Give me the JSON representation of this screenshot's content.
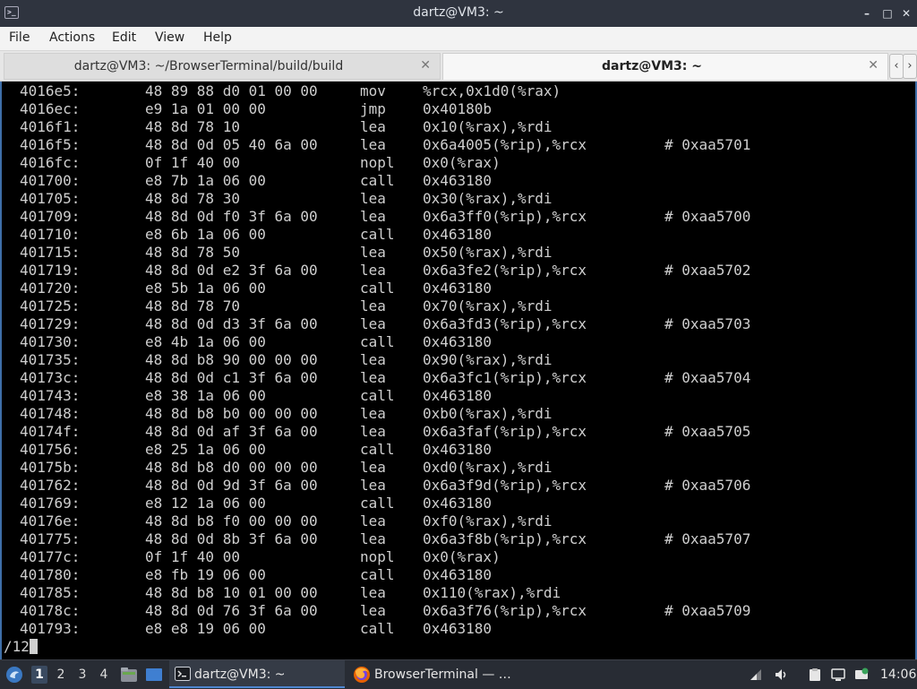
{
  "window": {
    "title": "dartz@VM3: ~",
    "minimize_glyph": "–",
    "maximize_glyph": "□",
    "close_glyph": "✕"
  },
  "menu": [
    "File",
    "Actions",
    "Edit",
    "View",
    "Help"
  ],
  "tabs": [
    {
      "label": "dartz@VM3: ~/BrowserTerminal/build/build",
      "active": false
    },
    {
      "label": "dartz@VM3: ~",
      "active": true
    }
  ],
  "tab_nav": {
    "prev": "‹",
    "next": "›"
  },
  "terminal": {
    "lines": [
      {
        "addr": "4016e5:",
        "bytes": "48 89 88 d0 01 00 00",
        "op": "mov",
        "args": "%rcx,0x1d0(%rax)",
        "comment": ""
      },
      {
        "addr": "4016ec:",
        "bytes": "e9 1a 01 00 00",
        "op": "jmp",
        "args": "0x40180b",
        "comment": ""
      },
      {
        "addr": "4016f1:",
        "bytes": "48 8d 78 10",
        "op": "lea",
        "args": "0x10(%rax),%rdi",
        "comment": ""
      },
      {
        "addr": "4016f5:",
        "bytes": "48 8d 0d 05 40 6a 00",
        "op": "lea",
        "args": "0x6a4005(%rip),%rcx",
        "comment": "# 0xaa5701"
      },
      {
        "addr": "4016fc:",
        "bytes": "0f 1f 40 00",
        "op": "nopl",
        "args": "0x0(%rax)",
        "comment": ""
      },
      {
        "addr": "401700:",
        "bytes": "e8 7b 1a 06 00",
        "op": "call",
        "args": "0x463180",
        "comment": ""
      },
      {
        "addr": "401705:",
        "bytes": "48 8d 78 30",
        "op": "lea",
        "args": "0x30(%rax),%rdi",
        "comment": ""
      },
      {
        "addr": "401709:",
        "bytes": "48 8d 0d f0 3f 6a 00",
        "op": "lea",
        "args": "0x6a3ff0(%rip),%rcx",
        "comment": "# 0xaa5700"
      },
      {
        "addr": "401710:",
        "bytes": "e8 6b 1a 06 00",
        "op": "call",
        "args": "0x463180",
        "comment": ""
      },
      {
        "addr": "401715:",
        "bytes": "48 8d 78 50",
        "op": "lea",
        "args": "0x50(%rax),%rdi",
        "comment": ""
      },
      {
        "addr": "401719:",
        "bytes": "48 8d 0d e2 3f 6a 00",
        "op": "lea",
        "args": "0x6a3fe2(%rip),%rcx",
        "comment": "# 0xaa5702"
      },
      {
        "addr": "401720:",
        "bytes": "e8 5b 1a 06 00",
        "op": "call",
        "args": "0x463180",
        "comment": ""
      },
      {
        "addr": "401725:",
        "bytes": "48 8d 78 70",
        "op": "lea",
        "args": "0x70(%rax),%rdi",
        "comment": ""
      },
      {
        "addr": "401729:",
        "bytes": "48 8d 0d d3 3f 6a 00",
        "op": "lea",
        "args": "0x6a3fd3(%rip),%rcx",
        "comment": "# 0xaa5703"
      },
      {
        "addr": "401730:",
        "bytes": "e8 4b 1a 06 00",
        "op": "call",
        "args": "0x463180",
        "comment": ""
      },
      {
        "addr": "401735:",
        "bytes": "48 8d b8 90 00 00 00",
        "op": "lea",
        "args": "0x90(%rax),%rdi",
        "comment": ""
      },
      {
        "addr": "40173c:",
        "bytes": "48 8d 0d c1 3f 6a 00",
        "op": "lea",
        "args": "0x6a3fc1(%rip),%rcx",
        "comment": "# 0xaa5704"
      },
      {
        "addr": "401743:",
        "bytes": "e8 38 1a 06 00",
        "op": "call",
        "args": "0x463180",
        "comment": ""
      },
      {
        "addr": "401748:",
        "bytes": "48 8d b8 b0 00 00 00",
        "op": "lea",
        "args": "0xb0(%rax),%rdi",
        "comment": ""
      },
      {
        "addr": "40174f:",
        "bytes": "48 8d 0d af 3f 6a 00",
        "op": "lea",
        "args": "0x6a3faf(%rip),%rcx",
        "comment": "# 0xaa5705"
      },
      {
        "addr": "401756:",
        "bytes": "e8 25 1a 06 00",
        "op": "call",
        "args": "0x463180",
        "comment": ""
      },
      {
        "addr": "40175b:",
        "bytes": "48 8d b8 d0 00 00 00",
        "op": "lea",
        "args": "0xd0(%rax),%rdi",
        "comment": ""
      },
      {
        "addr": "401762:",
        "bytes": "48 8d 0d 9d 3f 6a 00",
        "op": "lea",
        "args": "0x6a3f9d(%rip),%rcx",
        "comment": "# 0xaa5706"
      },
      {
        "addr": "401769:",
        "bytes": "e8 12 1a 06 00",
        "op": "call",
        "args": "0x463180",
        "comment": ""
      },
      {
        "addr": "40176e:",
        "bytes": "48 8d b8 f0 00 00 00",
        "op": "lea",
        "args": "0xf0(%rax),%rdi",
        "comment": ""
      },
      {
        "addr": "401775:",
        "bytes": "48 8d 0d 8b 3f 6a 00",
        "op": "lea",
        "args": "0x6a3f8b(%rip),%rcx",
        "comment": "# 0xaa5707"
      },
      {
        "addr": "40177c:",
        "bytes": "0f 1f 40 00",
        "op": "nopl",
        "args": "0x0(%rax)",
        "comment": ""
      },
      {
        "addr": "401780:",
        "bytes": "e8 fb 19 06 00",
        "op": "call",
        "args": "0x463180",
        "comment": ""
      },
      {
        "addr": "401785:",
        "bytes": "48 8d b8 10 01 00 00",
        "op": "lea",
        "args": "0x110(%rax),%rdi",
        "comment": ""
      },
      {
        "addr": "40178c:",
        "bytes": "48 8d 0d 76 3f 6a 00",
        "op": "lea",
        "args": "0x6a3f76(%rip),%rcx",
        "comment": "# 0xaa5709"
      },
      {
        "addr": "401793:",
        "bytes": "e8 e8 19 06 00",
        "op": "call",
        "args": "0x463180",
        "comment": ""
      }
    ],
    "prompt": "/12"
  },
  "taskbar": {
    "workspaces": [
      "1",
      "2",
      "3",
      "4"
    ],
    "active_workspace": "1",
    "tasks": [
      {
        "label": "dartz@VM3: ~",
        "icon": "terminal-icon",
        "active": true
      },
      {
        "label": "BrowserTerminal — …",
        "icon": "firefox-icon",
        "active": false
      }
    ],
    "clock": "14:06"
  },
  "colors": {
    "titlebar_bg": "#2f343f",
    "terminal_bg": "#000000",
    "terminal_fg": "#cfcfcf",
    "taskbar_bg": "#282c34",
    "accent": "#4f87d0"
  }
}
